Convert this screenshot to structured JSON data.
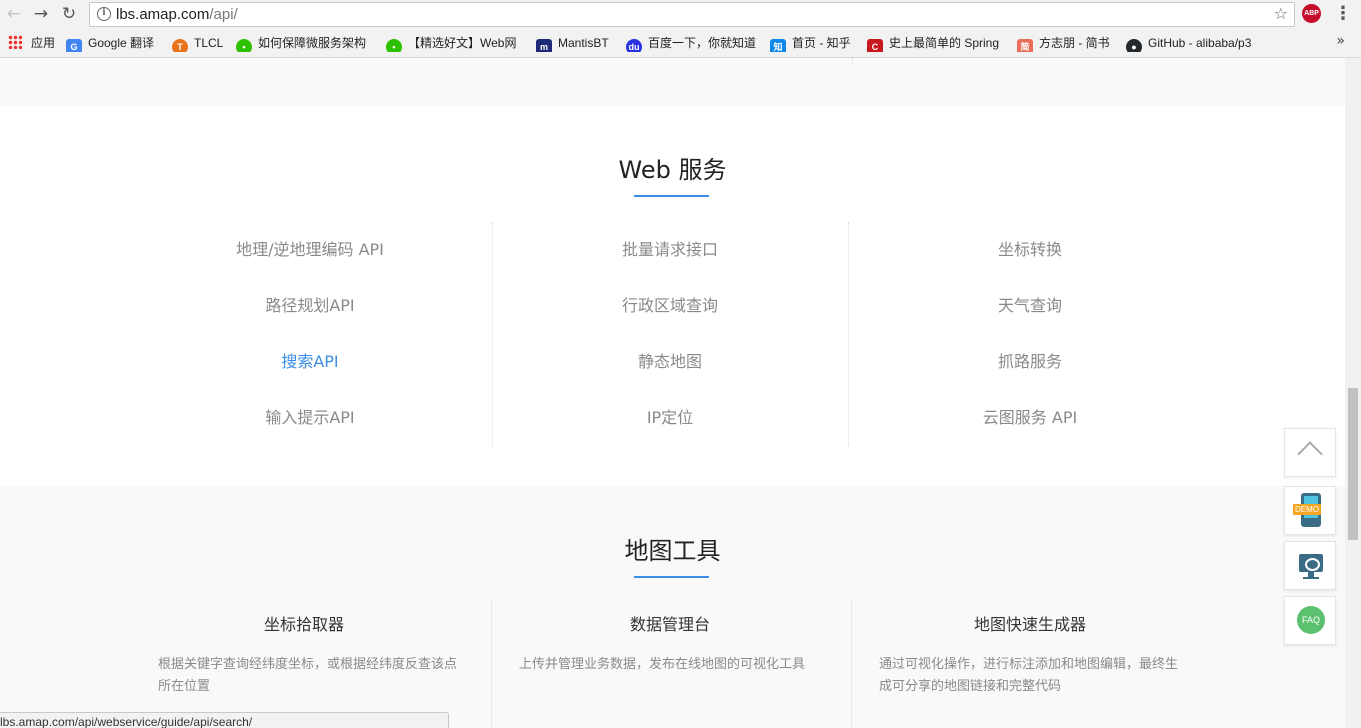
{
  "browser": {
    "url_host": "lbs.amap.com",
    "url_path": "/api/",
    "bookmarks": [
      {
        "label": "应用",
        "icon": "apps-grid-icon"
      },
      {
        "label": "Google 翻译",
        "icon": "google-translate-icon",
        "color": "#4285f4"
      },
      {
        "label": "TLCL",
        "icon": "tlcl-icon",
        "color": "#e8731a"
      },
      {
        "label": "如何保障微服务架构",
        "icon": "wechat-icon",
        "color": "#2dc100"
      },
      {
        "label": "【精选好文】Web网",
        "icon": "wechat-icon",
        "color": "#2dc100"
      },
      {
        "label": "MantisBT",
        "icon": "mantisbt-icon",
        "color": "#1e2a78"
      },
      {
        "label": "百度一下，你就知道",
        "icon": "baidu-icon",
        "color": "#2932e1"
      },
      {
        "label": "首页 - 知乎",
        "icon": "zhihu-icon",
        "color": "#0f88eb"
      },
      {
        "label": "史上最简单的 Spring",
        "icon": "csdn-icon",
        "color": "#c9171e"
      },
      {
        "label": "方志朋 - 简书",
        "icon": "jianshu-icon",
        "color": "#ea6f5a"
      },
      {
        "label": "GitHub - alibaba/p3",
        "icon": "github-icon",
        "color": "#24292e"
      }
    ],
    "more": "»"
  },
  "web_service": {
    "title": "Web 服务",
    "columns": [
      [
        "地理/逆地理编码 API",
        "路径规划API",
        "搜索API",
        "输入提示API"
      ],
      [
        "批量请求接口",
        "行政区域查询",
        "静态地图",
        "IP定位"
      ],
      [
        "坐标转换",
        "天气查询",
        "抓路服务",
        "云图服务 API"
      ]
    ],
    "active_item": "搜索API",
    "accent_color": "#3a8ee6"
  },
  "map_tools": {
    "title": "地图工具",
    "tools": [
      {
        "title": "坐标拾取器",
        "desc": "根据关键字查询经纬度坐标，或根据经纬度反查该点所在位置"
      },
      {
        "title": "数据管理台",
        "desc": "上传并管理业务数据，发布在线地图的可视化工具"
      },
      {
        "title": "地图快速生成器",
        "desc": "通过可视化操作，进行标注添加和地图编辑，最终生成可分享的地图链接和完整代码"
      }
    ]
  },
  "status_bar": {
    "url": "lbs.amap.com/api/webservice/guide/api/search/"
  },
  "floating": {
    "demo_label": "DEMO",
    "faq_label": "FAQ"
  }
}
